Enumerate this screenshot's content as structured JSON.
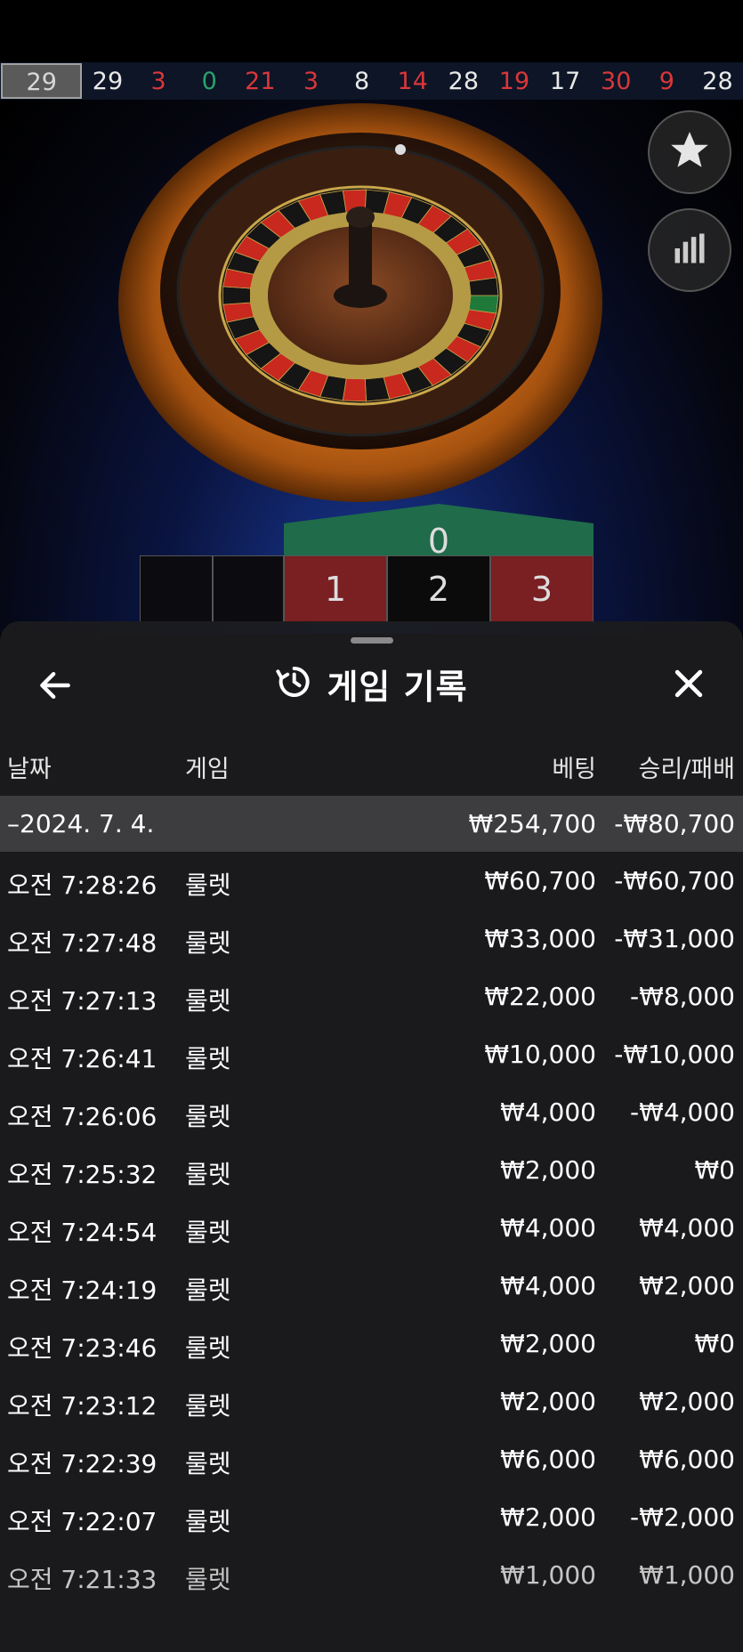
{
  "results_strip": [
    {
      "value": "29",
      "color": "gray"
    },
    {
      "value": "29",
      "color": "black"
    },
    {
      "value": "3",
      "color": "red"
    },
    {
      "value": "0",
      "color": "green"
    },
    {
      "value": "21",
      "color": "red"
    },
    {
      "value": "3",
      "color": "red"
    },
    {
      "value": "8",
      "color": "black"
    },
    {
      "value": "14",
      "color": "red"
    },
    {
      "value": "28",
      "color": "black"
    },
    {
      "value": "19",
      "color": "red"
    },
    {
      "value": "17",
      "color": "black"
    },
    {
      "value": "30",
      "color": "red"
    },
    {
      "value": "9",
      "color": "red"
    },
    {
      "value": "28",
      "color": "black"
    }
  ],
  "game": {
    "zero_label": "0",
    "numbers": [
      "1",
      "2",
      "3"
    ],
    "favorite_icon": "star-icon",
    "stats_icon": "bar-chart-icon"
  },
  "sheet": {
    "title": "게임 기록",
    "back_icon": "arrow-left-icon",
    "history_icon": "history-icon",
    "close_icon": "close-icon",
    "headers": {
      "date": "날짜",
      "game": "게임",
      "bet": "베팅",
      "result": "승리/패배"
    },
    "date_group": {
      "label": "–2024. 7. 4.",
      "total_bet": "₩254,700",
      "total_result": "-₩80,700"
    },
    "rows": [
      {
        "time": "오전 7:28:26",
        "game": "룰렛",
        "bet": "₩60,700",
        "result": "-₩60,700"
      },
      {
        "time": "오전 7:27:48",
        "game": "룰렛",
        "bet": "₩33,000",
        "result": "-₩31,000"
      },
      {
        "time": "오전 7:27:13",
        "game": "룰렛",
        "bet": "₩22,000",
        "result": "-₩8,000"
      },
      {
        "time": "오전 7:26:41",
        "game": "룰렛",
        "bet": "₩10,000",
        "result": "-₩10,000"
      },
      {
        "time": "오전 7:26:06",
        "game": "룰렛",
        "bet": "₩4,000",
        "result": "-₩4,000"
      },
      {
        "time": "오전 7:25:32",
        "game": "룰렛",
        "bet": "₩2,000",
        "result": "₩0"
      },
      {
        "time": "오전 7:24:54",
        "game": "룰렛",
        "bet": "₩4,000",
        "result": "₩4,000"
      },
      {
        "time": "오전 7:24:19",
        "game": "룰렛",
        "bet": "₩4,000",
        "result": "₩2,000"
      },
      {
        "time": "오전 7:23:46",
        "game": "룰렛",
        "bet": "₩2,000",
        "result": "₩0"
      },
      {
        "time": "오전 7:23:12",
        "game": "룰렛",
        "bet": "₩2,000",
        "result": "₩2,000"
      },
      {
        "time": "오전 7:22:39",
        "game": "룰렛",
        "bet": "₩6,000",
        "result": "₩6,000"
      },
      {
        "time": "오전 7:22:07",
        "game": "룰렛",
        "bet": "₩2,000",
        "result": "-₩2,000"
      },
      {
        "time": "오전 7:21:33",
        "game": "룰렛",
        "bet": "₩1,000",
        "result": "₩1,000"
      }
    ]
  },
  "colors": {
    "red": "#d9373b",
    "black": "#e8e8e8",
    "green": "#2aa36b",
    "sheet_bg": "#1c1c1e",
    "date_row_bg": "#3d3d40"
  }
}
